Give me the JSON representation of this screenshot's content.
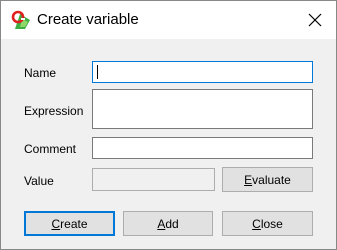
{
  "window": {
    "title": "Create variable"
  },
  "icons": {
    "app": "app-variable-icon",
    "close": "close-icon"
  },
  "form": {
    "name_label": "Name",
    "name_value": "",
    "expression_label": "Expression",
    "expression_value": "",
    "comment_label": "Comment",
    "comment_value": "",
    "value_label": "Value",
    "value_value": ""
  },
  "buttons": {
    "evaluate": {
      "pre": "",
      "accel": "E",
      "post": "valuate"
    },
    "create": {
      "pre": "",
      "accel": "C",
      "post": "reate"
    },
    "add": {
      "pre": "",
      "accel": "A",
      "post": "dd"
    },
    "close": {
      "pre": "",
      "accel": "C",
      "post": "lose"
    }
  },
  "colors": {
    "focus_border": "#0078d7",
    "button_face": "#e1e1e1",
    "dialog_bg": "#f0f0f0"
  }
}
